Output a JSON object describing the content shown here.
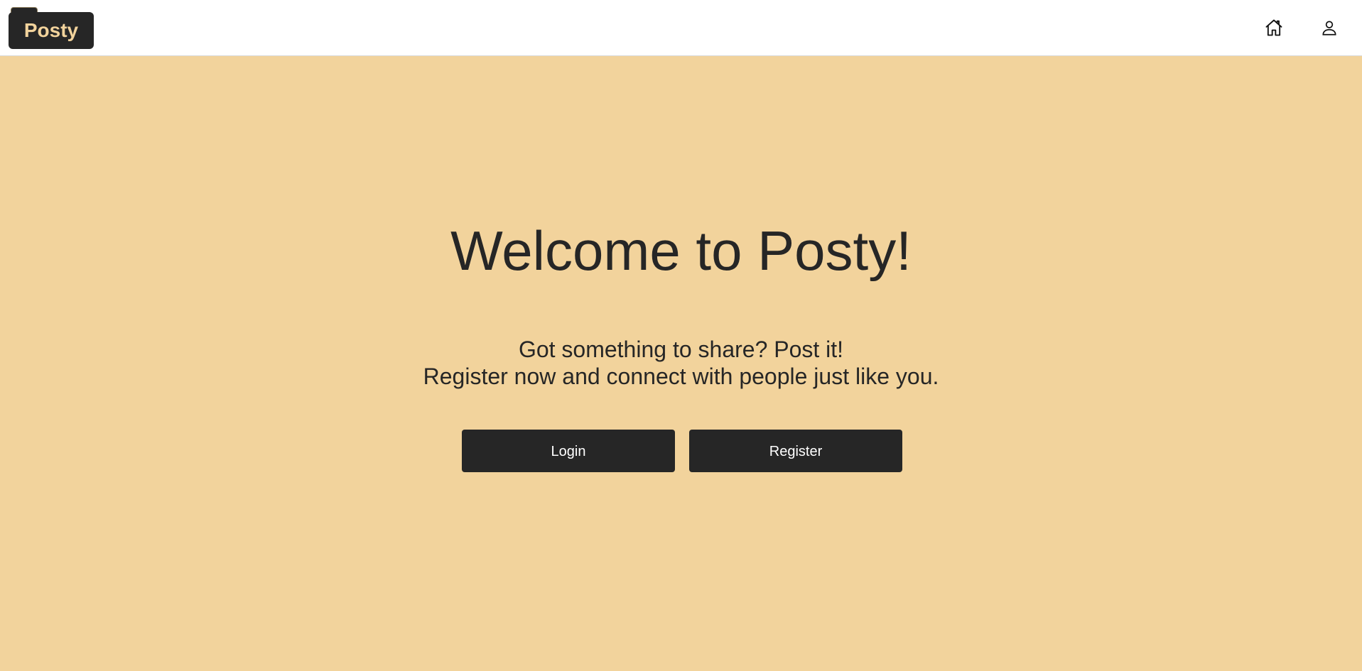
{
  "navbar": {
    "logo_text": "Posty",
    "icons": {
      "home": "home-icon",
      "profile": "user-icon"
    }
  },
  "hero": {
    "title": "Welcome to Posty!",
    "subtitle_line1": "Got something to share? Post it!",
    "subtitle_line2": "Register now and connect with people just like you."
  },
  "actions": {
    "login_label": "Login",
    "register_label": "Register"
  },
  "colors": {
    "background": "#f2d39c",
    "dark": "#262626",
    "navbar": "#ffffff"
  }
}
